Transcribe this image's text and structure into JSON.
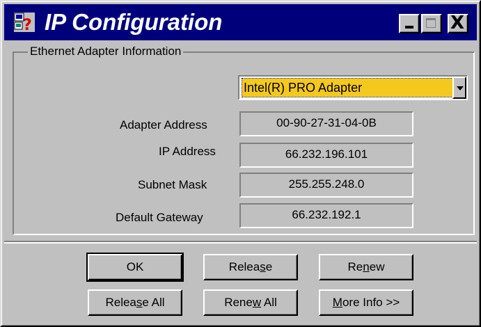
{
  "window": {
    "title": "IP Configuration",
    "controls": {
      "minimize": "_",
      "maximize": "□",
      "close": "X"
    },
    "icon": "network-help-icon"
  },
  "group": {
    "label": "Ethernet  Adapter Information"
  },
  "adapter_select": {
    "selected": "Intel(R) PRO Adapter",
    "highlight_color": "#f5c81e"
  },
  "fields": [
    {
      "label": "Adapter Address",
      "value": "00-90-27-31-04-0B"
    },
    {
      "label": "IP Address",
      "value": "66.232.196.101"
    },
    {
      "label": "Subnet Mask",
      "value": "255.255.248.0"
    },
    {
      "label": "Default Gateway",
      "value": "66.232.192.1"
    }
  ],
  "buttons": {
    "ok": "OK",
    "release": {
      "pre": "Relea",
      "accel": "s",
      "post": "e"
    },
    "renew": {
      "pre": "Re",
      "accel": "n",
      "post": "ew"
    },
    "release_all": {
      "pre": "Relea",
      "accel": "s",
      "post": "e All"
    },
    "renew_all": {
      "pre": "Rene",
      "accel": "w",
      "post": " All"
    },
    "more_info": {
      "pre": "",
      "accel": "M",
      "post": "ore Info >>"
    }
  },
  "colors": {
    "titlebar": "#00007b",
    "face": "#c0c0c0"
  }
}
